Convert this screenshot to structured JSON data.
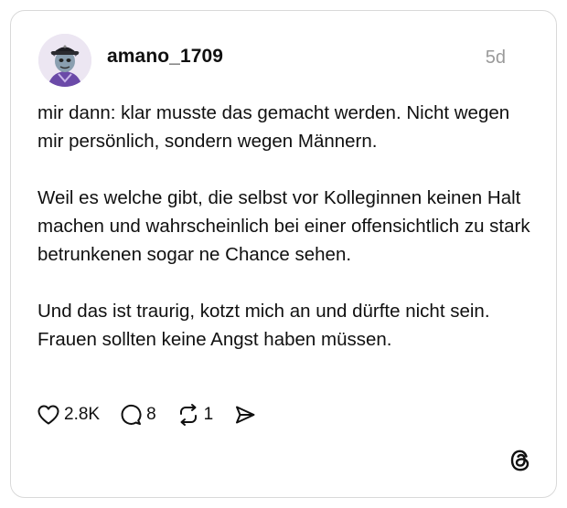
{
  "post": {
    "username": "amano_1709",
    "timestamp": "5d",
    "paragraphs": [
      "mir dann: klar musste das gemacht werden. Nicht wegen mir persönlich, sondern wegen Männern.",
      "Weil es welche gibt, die selbst vor Kolleginnen keinen Halt machen und wahrscheinlich bei einer offensichtlich zu stark betrunkenen sogar ne Chance sehen.",
      "Und das ist traurig, kotzt mich an und dürfte nicht sein. Frauen sollten keine Angst haben müssen."
    ]
  },
  "actions": {
    "like_icon": "heart-icon",
    "like_count": "2.8K",
    "reply_icon": "comment-icon",
    "reply_count": "8",
    "repost_icon": "repost-icon",
    "repost_count": "1",
    "share_icon": "send-icon"
  },
  "brand": {
    "logo_icon": "threads-logo-icon"
  },
  "colors": {
    "text": "#101010",
    "muted": "#9a9a9a",
    "border": "#d9d9d9",
    "background": "#ffffff"
  }
}
